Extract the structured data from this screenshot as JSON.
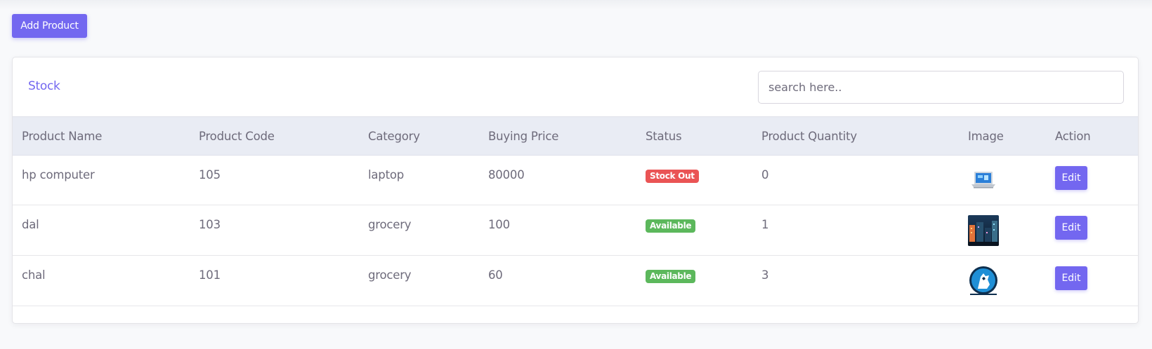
{
  "toolbar": {
    "add_label": "Add Product"
  },
  "card": {
    "title": "Stock",
    "search_placeholder": "search here.."
  },
  "table": {
    "headers": [
      "Product Name",
      "Product Code",
      "Category",
      "Buying Price",
      "Status",
      "Product Quantity",
      "Image",
      "Action"
    ],
    "rows": [
      {
        "name": "hp computer",
        "code": "105",
        "category": "laptop",
        "price": "80000",
        "status": "Stock Out",
        "status_color": "#ea5455",
        "quantity": "0",
        "image_icon": "laptop-product-image",
        "action": "Edit"
      },
      {
        "name": "dal",
        "code": "103",
        "category": "grocery",
        "price": "100",
        "status": "Available",
        "status_color": "#5cb85c",
        "quantity": "1",
        "image_icon": "night-city-product-image",
        "action": "Edit"
      },
      {
        "name": "chal",
        "code": "101",
        "category": "grocery",
        "price": "60",
        "status": "Available",
        "status_color": "#5cb85c",
        "quantity": "3",
        "image_icon": "wolf-logo-product-image",
        "action": "Edit"
      }
    ]
  },
  "colors": {
    "accent": "#7367f0",
    "header_bg": "#e9ecf4",
    "stock_out": "#ea5455",
    "available": "#5cb85c"
  }
}
